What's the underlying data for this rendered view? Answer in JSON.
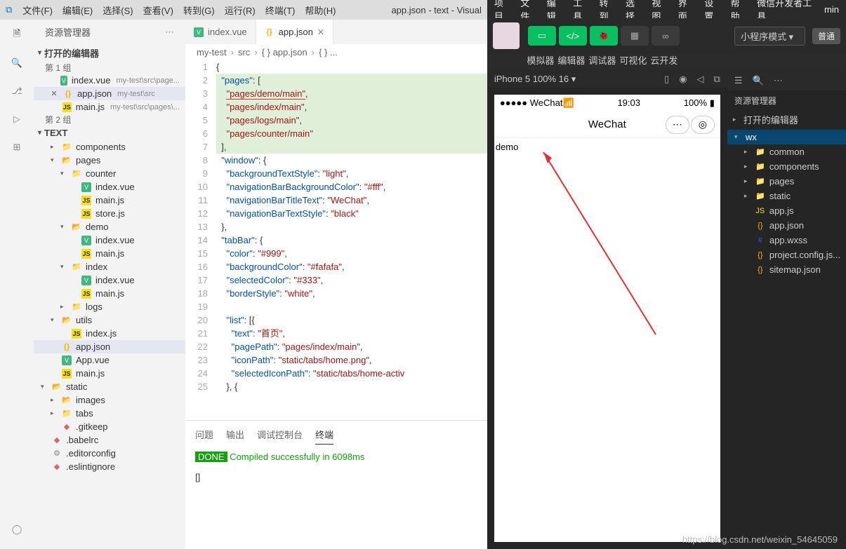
{
  "vscode": {
    "menus": [
      "文件(F)",
      "编辑(E)",
      "选择(S)",
      "查看(V)",
      "转到(G)",
      "运行(R)",
      "终端(T)",
      "帮助(H)"
    ],
    "title": "app.json - text - Visual",
    "sidebarTitle": "资源管理器",
    "openEditorsTitle": "打开的编辑器",
    "group1": "第 1 组",
    "group2": "第 2 组",
    "opened": [
      {
        "icon": "vue",
        "name": "index.vue",
        "tail": "my-test\\src\\page..."
      },
      {
        "icon": "json",
        "name": "app.json",
        "tail": "my-test\\src",
        "sel": true,
        "close": true
      },
      {
        "icon": "js",
        "name": "main.js",
        "tail": "my-test\\src\\pages\\..."
      }
    ],
    "projectName": "TEXT",
    "tree": [
      {
        "d": 1,
        "t": "chev",
        "icon": "folder",
        "name": "components"
      },
      {
        "d": 1,
        "t": "open",
        "icon": "folder-g",
        "name": "pages"
      },
      {
        "d": 2,
        "t": "open",
        "icon": "folder",
        "name": "counter"
      },
      {
        "d": 3,
        "icon": "vue",
        "name": "index.vue"
      },
      {
        "d": 3,
        "icon": "js",
        "name": "main.js"
      },
      {
        "d": 3,
        "icon": "js",
        "name": "store.js"
      },
      {
        "d": 2,
        "t": "open",
        "icon": "folder-g",
        "name": "demo"
      },
      {
        "d": 3,
        "icon": "vue",
        "name": "index.vue"
      },
      {
        "d": 3,
        "icon": "js",
        "name": "main.js"
      },
      {
        "d": 2,
        "t": "open",
        "icon": "folder",
        "name": "index"
      },
      {
        "d": 3,
        "icon": "vue",
        "name": "index.vue"
      },
      {
        "d": 3,
        "icon": "js",
        "name": "main.js"
      },
      {
        "d": 2,
        "t": "chev",
        "icon": "folder",
        "name": "logs"
      },
      {
        "d": 1,
        "t": "open",
        "icon": "folder-o",
        "name": "utils"
      },
      {
        "d": 2,
        "icon": "js",
        "name": "index.js"
      },
      {
        "d": 1,
        "icon": "json",
        "name": "app.json",
        "sel": true
      },
      {
        "d": 1,
        "icon": "vue",
        "name": "App.vue"
      },
      {
        "d": 1,
        "icon": "js",
        "name": "main.js"
      },
      {
        "d": 0,
        "t": "open",
        "icon": "folder-o",
        "name": "static"
      },
      {
        "d": 1,
        "t": "chev",
        "icon": "folder-g",
        "name": "images"
      },
      {
        "d": 1,
        "t": "chev",
        "icon": "folder",
        "name": "tabs"
      },
      {
        "d": 1,
        "icon": "dot",
        "name": ".gitkeep"
      },
      {
        "d": 0,
        "icon": "dot",
        "name": ".babelrc"
      },
      {
        "d": 0,
        "icon": "gear",
        "name": ".editorconfig"
      },
      {
        "d": 0,
        "icon": "dot",
        "name": ".eslintignore"
      }
    ],
    "tabs": [
      {
        "icon": "vue",
        "label": "index.vue"
      },
      {
        "icon": "json",
        "label": "app.json",
        "active": true
      }
    ],
    "breadcrumb": [
      "my-test",
      "src",
      "{ } app.json",
      "{ } ..."
    ],
    "code": [
      {
        "n": 1,
        "h": 0,
        "html": "<span class='p'>{</span>"
      },
      {
        "n": 2,
        "h": 1,
        "html": "  <span class='k'>\"pages\"</span><span class='p'>: [</span>"
      },
      {
        "n": 3,
        "h": 1,
        "html": "    <span class='s underline'>\"pages/demo/main\"</span><span class='p'>,</span>"
      },
      {
        "n": 4,
        "h": 1,
        "html": "    <span class='s'>\"pages/index/main\"</span><span class='p'>,</span>"
      },
      {
        "n": 5,
        "h": 1,
        "html": "    <span class='s'>\"pages/logs/main\"</span><span class='p'>,</span>"
      },
      {
        "n": 6,
        "h": 1,
        "html": "    <span class='s'>\"pages/counter/main\"</span>"
      },
      {
        "n": 7,
        "h": 1,
        "html": "  <span class='p'>],</span>"
      },
      {
        "n": 8,
        "h": 0,
        "html": "  <span class='k'>\"window\"</span><span class='p'>: {</span>"
      },
      {
        "n": 9,
        "h": 0,
        "html": "    <span class='k'>\"backgroundTextStyle\"</span><span class='p'>: </span><span class='s'>\"light\"</span><span class='p'>,</span>"
      },
      {
        "n": 10,
        "h": 0,
        "html": "    <span class='k'>\"navigationBarBackgroundColor\"</span><span class='p'>: </span><span class='s'>\"#fff\"</span><span class='p'>,</span>"
      },
      {
        "n": 11,
        "h": 0,
        "html": "    <span class='k'>\"navigationBarTitleText\"</span><span class='p'>: </span><span class='s'>\"WeChat\"</span><span class='p'>,</span>"
      },
      {
        "n": 12,
        "h": 0,
        "html": "    <span class='k'>\"navigationBarTextStyle\"</span><span class='p'>: </span><span class='s'>\"black\"</span>"
      },
      {
        "n": 13,
        "h": 0,
        "html": "  <span class='p'>},</span>"
      },
      {
        "n": 14,
        "h": 0,
        "html": "  <span class='k'>\"tabBar\"</span><span class='p'>: {</span>"
      },
      {
        "n": 15,
        "h": 0,
        "html": "    <span class='k'>\"color\"</span><span class='p'>: </span><span class='s'>\"#999\"</span><span class='p'>,</span>"
      },
      {
        "n": 16,
        "h": 0,
        "html": "    <span class='k'>\"backgroundColor\"</span><span class='p'>: </span><span class='s'>\"#fafafa\"</span><span class='p'>,</span>"
      },
      {
        "n": 17,
        "h": 0,
        "html": "    <span class='k'>\"selectedColor\"</span><span class='p'>: </span><span class='s'>\"#333\"</span><span class='p'>,</span>"
      },
      {
        "n": 18,
        "h": 0,
        "html": "    <span class='k'>\"borderStyle\"</span><span class='p'>: </span><span class='s'>\"white\"</span><span class='p'>,</span>"
      },
      {
        "n": 19,
        "h": 0,
        "html": ""
      },
      {
        "n": 20,
        "h": 0,
        "html": "    <span class='k'>\"list\"</span><span class='p'>: [{</span>"
      },
      {
        "n": 21,
        "h": 0,
        "html": "      <span class='k'>\"text\"</span><span class='p'>: </span><span class='s'>\"首页\"</span><span class='p'>,</span>"
      },
      {
        "n": 22,
        "h": 0,
        "html": "      <span class='k'>\"pagePath\"</span><span class='p'>: </span><span class='s'>\"pages/index/main\"</span><span class='p'>,</span>"
      },
      {
        "n": 23,
        "h": 0,
        "html": "      <span class='k'>\"iconPath\"</span><span class='p'>: </span><span class='s'>\"static/tabs/home.png\"</span><span class='p'>,</span>"
      },
      {
        "n": 24,
        "h": 0,
        "html": "      <span class='k'>\"selectedIconPath\"</span><span class='p'>: </span><span class='s'>\"static/tabs/home-activ</span>"
      },
      {
        "n": 25,
        "h": 0,
        "html": "    <span class='p'>}, {</span>"
      }
    ],
    "panelTabs": [
      "问题",
      "输出",
      "调试控制台",
      "终端"
    ],
    "panelActive": 3,
    "term": {
      "done": "DONE",
      "msg": " Compiled successfully in 6098ms",
      "prompt": "[]"
    }
  },
  "wx": {
    "menus": [
      "项目",
      "文件",
      "编辑",
      "工具",
      "转到",
      "选择",
      "视图",
      "界面",
      "设置",
      "帮助",
      "微信开发者工具",
      "min"
    ],
    "btnLabels": [
      "模拟器",
      "编辑器",
      "调试器",
      "可视化",
      "云开发"
    ],
    "mode": "小程序模式",
    "extra": "普通",
    "simLabel": "iPhone 5 100% 16 ▾",
    "phone": {
      "carrier": "●●●●● WeChat",
      "wifi": "📶",
      "time": "19:03",
      "battery": "100%",
      "navTitle": "WeChat",
      "content": "demo"
    },
    "sideTitle": "资源管理器",
    "sideOpen": "打开的编辑器",
    "tree": [
      {
        "d": 0,
        "t": "open",
        "name": "wx",
        "sel": true
      },
      {
        "d": 1,
        "t": "chev",
        "icon": "folder",
        "name": "common"
      },
      {
        "d": 1,
        "t": "chev",
        "icon": "folder",
        "name": "components"
      },
      {
        "d": 1,
        "t": "chev",
        "icon": "folder",
        "name": "pages"
      },
      {
        "d": 1,
        "t": "chev",
        "icon": "folder",
        "name": "static"
      },
      {
        "d": 1,
        "icon": "js",
        "name": "app.js"
      },
      {
        "d": 1,
        "icon": "json",
        "name": "app.json"
      },
      {
        "d": 1,
        "icon": "css",
        "name": "app.wxss"
      },
      {
        "d": 1,
        "icon": "json",
        "name": "project.config.js..."
      },
      {
        "d": 1,
        "icon": "json",
        "name": "sitemap.json"
      }
    ]
  },
  "watermark": "https://blog.csdn.net/weixin_54645059"
}
